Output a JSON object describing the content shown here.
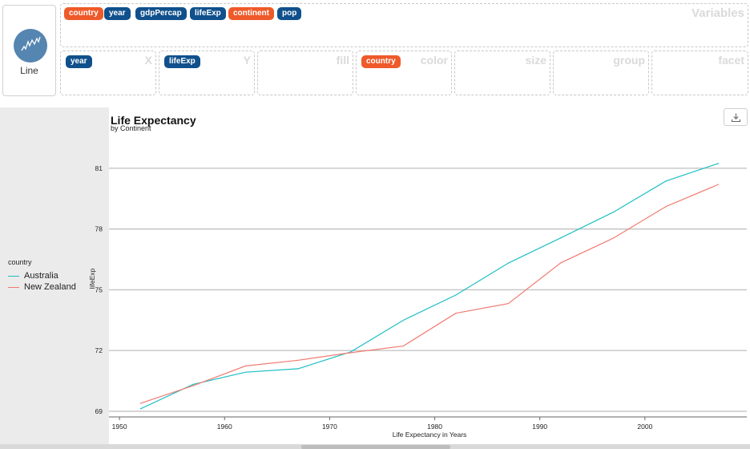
{
  "geom": {
    "label": "Line",
    "icon": "line-chart-icon"
  },
  "variables": {
    "title": "Variables",
    "items": [
      {
        "label": "country",
        "kind": "categorical"
      },
      {
        "label": "year",
        "kind": "numeric"
      },
      {
        "label": "gdpPercap",
        "kind": "numeric"
      },
      {
        "label": "lifeExp",
        "kind": "numeric"
      },
      {
        "label": "continent",
        "kind": "categorical"
      },
      {
        "label": "pop",
        "kind": "numeric"
      }
    ]
  },
  "mappings": [
    {
      "label": "X",
      "value": "year",
      "kind": "numeric"
    },
    {
      "label": "Y",
      "value": "lifeExp",
      "kind": "numeric"
    },
    {
      "label": "fill",
      "value": "",
      "kind": ""
    },
    {
      "label": "color",
      "value": "country",
      "kind": "categorical"
    },
    {
      "label": "size",
      "value": "",
      "kind": ""
    },
    {
      "label": "group",
      "value": "",
      "kind": ""
    },
    {
      "label": "facet",
      "value": "",
      "kind": ""
    }
  ],
  "colors": {
    "numeric_pill": "#10508c",
    "categorical_pill": "#ef5a2a",
    "australia": "#1fbfc4",
    "new_zealand": "#f07b72"
  },
  "download": {
    "icon": "download-icon"
  },
  "chart_data": {
    "type": "line",
    "title": "Life Expectancy",
    "subtitle": "by Continent",
    "xlabel": "Life Expectancy in Years",
    "ylabel": "lifeExp",
    "xlim": [
      1949,
      2010
    ],
    "ylim": [
      68.8,
      82.3
    ],
    "xticks": [
      1950,
      1960,
      1970,
      1980,
      1990,
      2000
    ],
    "yticks": [
      69,
      72,
      75,
      78,
      81
    ],
    "grid": "horizontal",
    "legend_title": "country",
    "legend_position": "left",
    "x": [
      1952,
      1957,
      1962,
      1967,
      1972,
      1977,
      1982,
      1987,
      1992,
      1997,
      2002,
      2007
    ],
    "series": [
      {
        "name": "Australia",
        "color": "#1fbfc4",
        "values": [
          69.12,
          70.33,
          70.93,
          71.1,
          71.93,
          73.49,
          74.74,
          76.32,
          77.56,
          78.83,
          80.37,
          81.24
        ]
      },
      {
        "name": "New Zealand",
        "color": "#f07b72",
        "values": [
          69.39,
          70.26,
          71.24,
          71.52,
          71.89,
          72.22,
          73.84,
          74.32,
          76.33,
          77.55,
          79.11,
          80.2
        ]
      }
    ]
  }
}
